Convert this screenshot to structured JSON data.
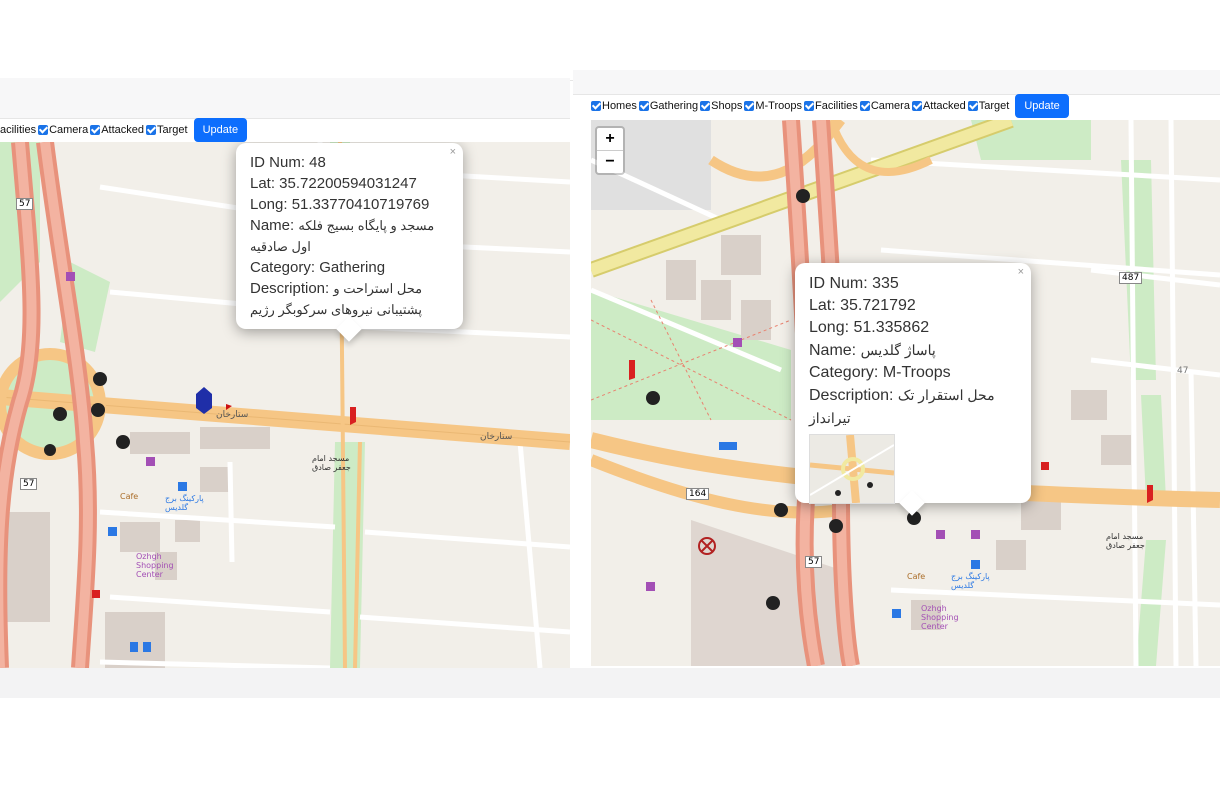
{
  "filters": {
    "homes": "Homes",
    "gathering": "Gathering",
    "shops": "Shops",
    "mtroops": "M-Troops",
    "facilities": "Facilities",
    "camera": "Camera",
    "attacked": "Attacked",
    "target": "Target"
  },
  "left_filters": {
    "facilities_partial": "acilities",
    "camera": "Camera",
    "attacked": "Attacked",
    "target": "Target"
  },
  "update_label": "Update",
  "left_popup": {
    "close": "×",
    "id": "ID Num: 48",
    "lat": "Lat: 35.72200594031247",
    "long": "Long: 51.33770410719769",
    "name_label": "Name: ",
    "name_value": "مسجد و پایگاه بسیج فلکه",
    "name_cont": "اول صادقیه",
    "category": "Category: Gathering",
    "desc_label": "Description: ",
    "desc_value": "محل استراحت و",
    "desc_cont": "پشتیبانی نیروهای سرکوبگر رژیم"
  },
  "right_popup": {
    "close": "×",
    "id": "ID Num: 335",
    "lat": "Lat: 35.721792",
    "long": "Long: 51.335862",
    "name_label": "Name: ",
    "name_value": "پاساژ گلدیس",
    "category": "Category: M-Troops",
    "desc_label": "Description: ",
    "desc_value": "محل استقرار تک",
    "desc_cont": "تیرانداز"
  },
  "zoom": {
    "in": "+",
    "out": "−"
  },
  "map_labels_left": {
    "l57a": "57",
    "l57b": "57",
    "sattarkhan": "ستارخان",
    "sattarkhan2": "ستارخان",
    "shopping": "Ozhgh Shopping Center",
    "park": "پارکینگ برج گلدیس",
    "mosque": "مسجد امام جعفر صادق",
    "cafe": "Cafe"
  },
  "map_labels_right": {
    "l164": "164",
    "l57": "57",
    "l487": "487",
    "l47": "47",
    "shopping": "Ozhgh Shopping Center",
    "park": "پارکینگ برج گلدیس",
    "mosque": "مسجد امام جعفر صادق",
    "cafe": "Cafe"
  },
  "colors": {
    "primary": "#0d6efd",
    "major_road": "#e8927c",
    "secondary_road": "#f6c685",
    "trunk": "#f1e9a0",
    "park": "#cdebc5",
    "land": "#f2efe9",
    "building": "#d9d0c9"
  }
}
